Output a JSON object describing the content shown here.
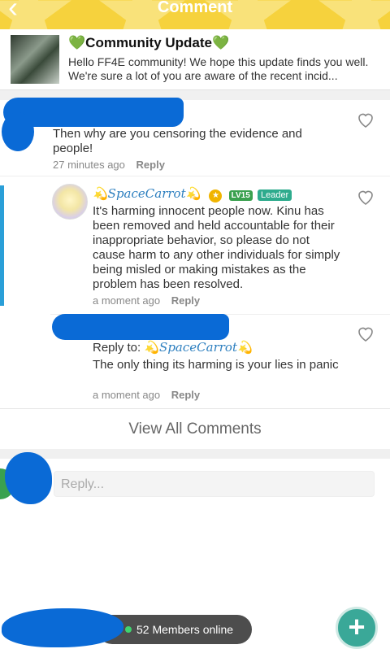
{
  "header": {
    "title": "Comment",
    "back_icon": "chevron-left-icon"
  },
  "post": {
    "title": "💚Community Update💚",
    "excerpt": "Hello FF4E community! We hope this update finds you well. We're sure a lot of you are aware of the recent incid..."
  },
  "comments": [
    {
      "text": "Then why are you censoring the evidence and people!",
      "time": "27 minutes ago",
      "reply_label": "Reply"
    },
    {
      "username": "💫SpaceCarrot💫",
      "level": "LV15",
      "role": "Leader",
      "text": "It's harming innocent people now. Kinu has been removed and held accountable for their inappropriate behavior, so please do not cause harm to any other individuals for simply being misled or making mistakes as the problem has been resolved.",
      "time": "a moment ago",
      "reply_label": "Reply"
    },
    {
      "reply_to_label": "Reply to:",
      "reply_to_user": "💫SpaceCarrot💫",
      "text": "The only thing its harming is your lies in panic",
      "time": "a moment ago",
      "reply_label": "Reply"
    }
  ],
  "view_all": "View All Comments",
  "reply_box": {
    "placeholder": "Reply..."
  },
  "online": {
    "text": "52 Members online"
  },
  "colors": {
    "header": "#f6d23d",
    "accent": "#2a9fd8",
    "fab": "#3aa898",
    "redaction": "#0a6ad6"
  }
}
